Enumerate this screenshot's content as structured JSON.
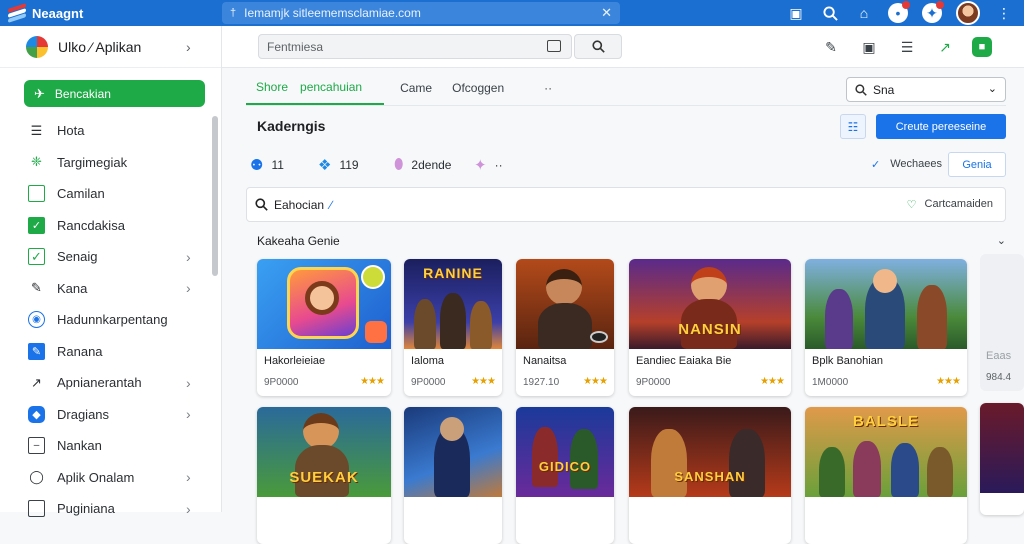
{
  "app": {
    "title": "Neaagnt",
    "url": "Iemamjk sitleememsclamiae.com"
  },
  "topbar": {
    "icons": [
      "bookmark-icon",
      "search-icon",
      "home-icon",
      "notification-icon",
      "extension-icon",
      "avatar",
      "more-vert-icon"
    ]
  },
  "sidebar": {
    "header": "Ulko ⁄ Aplikan",
    "active": "Bencakian",
    "items": [
      {
        "label": "Hota",
        "icon": "list-icon",
        "chevron": false
      },
      {
        "label": "Targimegiak",
        "icon": "puzzle-icon",
        "chevron": false
      },
      {
        "label": "Camilan",
        "icon": "square-icon",
        "chevron": false
      },
      {
        "label": "Rancdakisa",
        "icon": "check-box-icon",
        "chevron": false
      },
      {
        "label": "Senaig",
        "icon": "check-box-icon",
        "chevron": true
      },
      {
        "label": "Kana",
        "icon": "pen-icon",
        "chevron": true
      },
      {
        "label": "Hadunnkarpentang",
        "icon": "globe-icon",
        "chevron": false
      },
      {
        "label": "Ranana",
        "icon": "edit-box-icon",
        "chevron": false
      },
      {
        "label": "Apnianerantah",
        "icon": "rocket-icon",
        "chevron": true
      },
      {
        "label": "Dragians",
        "icon": "shield-icon",
        "chevron": true
      },
      {
        "label": "Nankan",
        "icon": "minus-box-icon",
        "chevron": false
      },
      {
        "label": "Aplik Onalam",
        "icon": "chat-icon",
        "chevron": true
      },
      {
        "label": "Puginiana",
        "icon": "document-icon",
        "chevron": true
      }
    ]
  },
  "toolbar": {
    "search_placeholder": "Fentmiesa"
  },
  "tabs": [
    {
      "label": "Shore",
      "label2": "pencahuian",
      "active": true
    },
    {
      "label": "Came",
      "active": false
    },
    {
      "label": "Ofcoggen",
      "active": false
    },
    {
      "label": "··",
      "active": false
    }
  ],
  "select": {
    "value": "Sna"
  },
  "page": {
    "title": "Kaderngis",
    "create_label": "Creute pereeseine"
  },
  "stats": [
    {
      "icon": "people-icon",
      "value": "11"
    },
    {
      "icon": "puzzle-icon",
      "value": "119"
    },
    {
      "icon": "gamepad-icon",
      "value": "2dende"
    },
    {
      "icon": "sparkle-icon",
      "value": "··"
    }
  ],
  "check_label": "Wechaees",
  "game_button": "Genia",
  "filter": {
    "value": "Eahocian",
    "right_label": "Cartcamaiden"
  },
  "section": {
    "title": "Kakeaha Genie"
  },
  "cards_row1": [
    {
      "name": "Hakorleieiae",
      "count": "9P0000",
      "stars": "★★★"
    },
    {
      "name": "Ialoma",
      "count": "9P0000",
      "stars": "★★★",
      "art_title": "RANINE"
    },
    {
      "name": "Nanaitsa",
      "count": "1927.10",
      "stars": "★★★"
    },
    {
      "name": "Eandiec Eaiaka Bie",
      "count": "9P0000",
      "stars": "★★★",
      "art_title": "NANSIN"
    },
    {
      "name": "Bplk Banohian",
      "count": "1M0000",
      "stars": "★★★"
    },
    {
      "name": "Eaas",
      "count": "984.4",
      "stars": ""
    }
  ],
  "cards_row2": [
    {
      "art_title": "SUEKAK"
    },
    {
      "art_title": ""
    },
    {
      "art_title": "GIDICO"
    },
    {
      "art_title": "SANSHAN"
    },
    {
      "art_title": "BALSLE"
    },
    {
      "art_title": ""
    }
  ],
  "colors": {
    "topbar": "#1a6fd1",
    "accent_green": "#1faa48",
    "accent_blue": "#1a73e8",
    "star": "#e6a100"
  }
}
